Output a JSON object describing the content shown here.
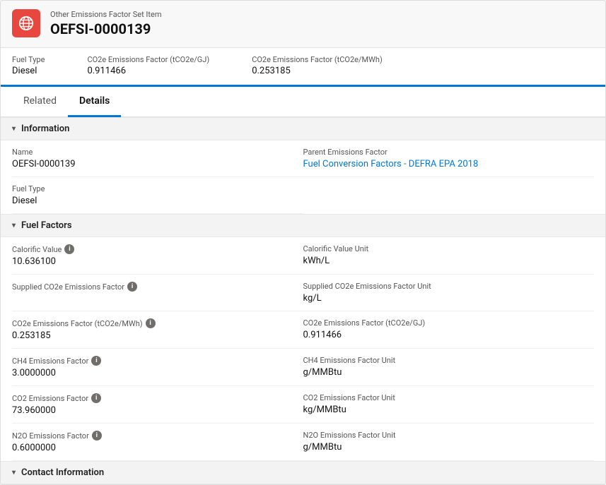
{
  "header": {
    "icon_alt": "globe-icon",
    "subtitle": "Other Emissions Factor Set Item",
    "title": "OEFSI-0000139"
  },
  "meta_fields": [
    {
      "label": "Fuel Type",
      "value": "Diesel"
    },
    {
      "label": "CO2e Emissions Factor (tCO2e/GJ)",
      "value": "0.911466"
    },
    {
      "label": "CO2e Emissions Factor (tCO2e/MWh)",
      "value": "0.253185"
    }
  ],
  "tabs": [
    {
      "label": "Related",
      "active": false
    },
    {
      "label": "Details",
      "active": true
    }
  ],
  "sections": [
    {
      "id": "information",
      "title": "Information",
      "expanded": true,
      "fields": [
        {
          "label": "Name",
          "value": "OEFSI-0000139",
          "span": 1,
          "info": false
        },
        {
          "label": "Parent Emissions Factor",
          "value": "Fuel Conversion Factors - DEFRA EPA 2018",
          "span": 1,
          "info": false,
          "link": true
        },
        {
          "label": "Fuel Type",
          "value": "Diesel",
          "span": 1,
          "info": false
        }
      ]
    },
    {
      "id": "fuel-factors",
      "title": "Fuel Factors",
      "expanded": true,
      "fields": [
        {
          "label": "Calorific Value",
          "value": "10.636100",
          "span": 1,
          "info": true
        },
        {
          "label": "Calorific Value Unit",
          "value": "kWh/L",
          "span": 1,
          "info": false
        },
        {
          "label": "Supplied CO2e Emissions Factor",
          "value": "",
          "span": 1,
          "info": true
        },
        {
          "label": "Supplied CO2e Emissions Factor Unit",
          "value": "kg/L",
          "span": 1,
          "info": false
        },
        {
          "label": "CO2e Emissions Factor (tCO2e/MWh)",
          "value": "0.253185",
          "span": 1,
          "info": true
        },
        {
          "label": "CO2e Emissions Factor (tCO2e/GJ)",
          "value": "0.911466",
          "span": 1,
          "info": false
        },
        {
          "label": "CH4 Emissions Factor",
          "value": "3.0000000",
          "span": 1,
          "info": true
        },
        {
          "label": "CH4 Emissions Factor Unit",
          "value": "g/MMBtu",
          "span": 1,
          "info": false
        },
        {
          "label": "CO2 Emissions Factor",
          "value": "73.960000",
          "span": 1,
          "info": true
        },
        {
          "label": "CO2 Emissions Factor Unit",
          "value": "kg/MMBtu",
          "span": 1,
          "info": false
        },
        {
          "label": "N2O Emissions Factor",
          "value": "0.6000000",
          "span": 1,
          "info": true
        },
        {
          "label": "N2O Emissions Factor Unit",
          "value": "g/MMBtu",
          "span": 1,
          "info": false
        }
      ]
    }
  ],
  "more_section_label": "Contact Information",
  "icons": {
    "info": "i",
    "chevron_down": "▾",
    "globe": "🌐"
  }
}
